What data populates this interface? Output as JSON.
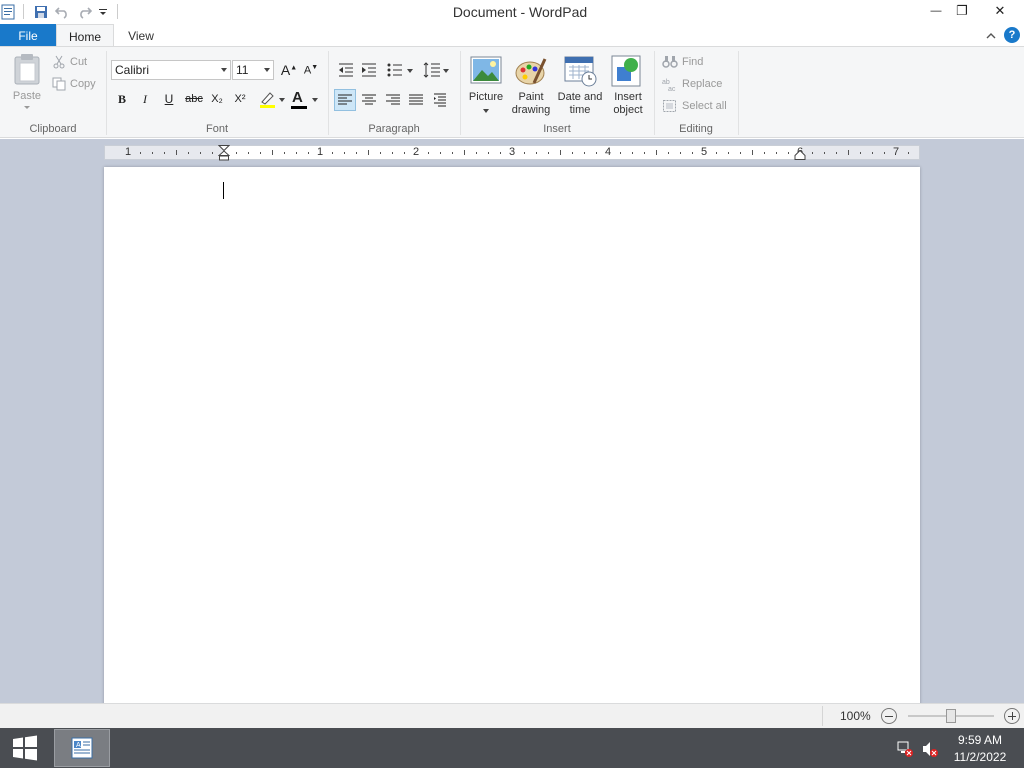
{
  "window": {
    "title": "Document - WordPad",
    "minimize_glyph": "—",
    "restore_glyph": "❐",
    "close_glyph": "✕"
  },
  "tabs": {
    "file": "File",
    "home": "Home",
    "view": "View"
  },
  "ribbon": {
    "clipboard": {
      "label": "Clipboard",
      "paste": "Paste",
      "cut": "Cut",
      "copy": "Copy"
    },
    "font": {
      "label": "Font",
      "family": "Calibri",
      "size": "11",
      "bold": "B",
      "italic": "I",
      "underline": "U",
      "strikethrough": "abc",
      "subscript": "X₂",
      "superscript": "X²",
      "color_letter": "A"
    },
    "paragraph": {
      "label": "Paragraph"
    },
    "insert": {
      "label": "Insert",
      "picture": "Picture",
      "paint_drawing": [
        "Paint",
        "drawing"
      ],
      "date_time": [
        "Date and",
        "time"
      ],
      "insert_object": [
        "Insert",
        "object"
      ]
    },
    "editing": {
      "label": "Editing",
      "find": "Find",
      "replace": "Replace",
      "select_all": "Select all"
    }
  },
  "ruler": {
    "numbers": [
      "1",
      "1",
      "2",
      "3",
      "4",
      "5",
      "6",
      "7"
    ]
  },
  "status": {
    "zoom": "100%"
  },
  "taskbar": {
    "time": "9:59 AM",
    "date": "11/2/2022"
  },
  "colors": {
    "file_tab": "#1979ca",
    "font_color_bar": "#000000",
    "highlight_bar": "#ffff00"
  }
}
